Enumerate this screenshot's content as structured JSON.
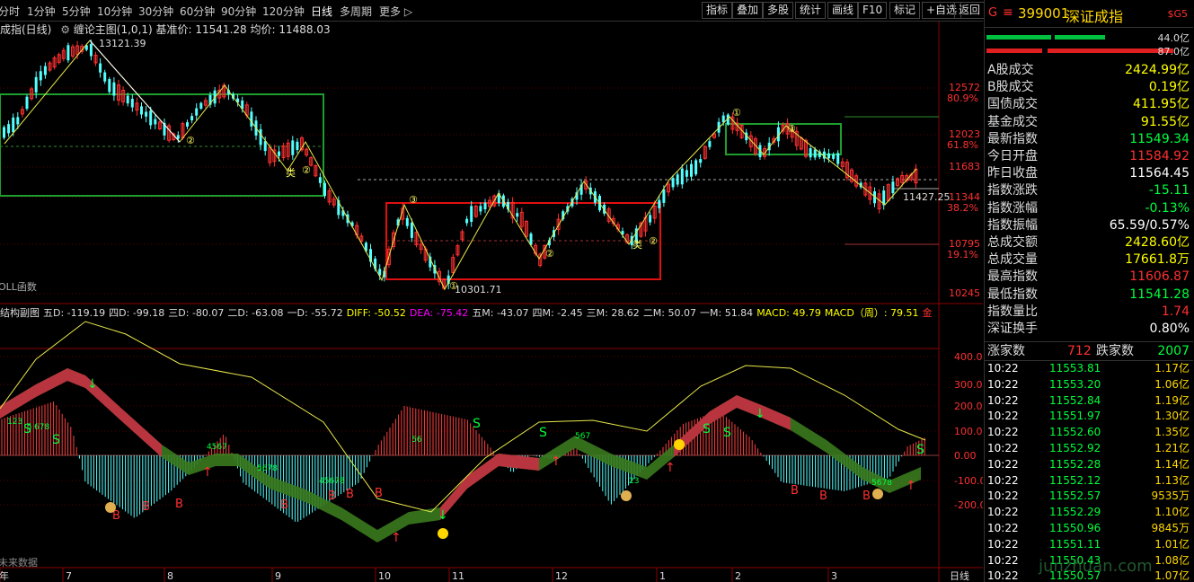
{
  "periods": [
    "分时",
    "1分钟",
    "5分钟",
    "10分钟",
    "30分钟",
    "60分钟",
    "90分钟",
    "120分钟",
    "日线",
    "多周期",
    "更多 ▷"
  ],
  "active_period": "日线",
  "toolbar": [
    "指标",
    "叠加",
    "多股",
    "统计",
    "画线",
    "F10",
    "标记",
    "+自选",
    "返回"
  ],
  "main_info": {
    "title": "成指(日线)",
    "formula": "缠论主图(1,0,1)",
    "base": "基准价: 11541.28",
    "avg": "均价: 11488.03"
  },
  "main_axis": [
    {
      "v": "12572",
      "p": "80.9%"
    },
    {
      "v": "12023",
      "p": "61.8%"
    },
    {
      "v": "11683",
      "p": ""
    },
    {
      "v": "11344",
      "p": "38.2%"
    },
    {
      "v": "10795",
      "p": "19.1%"
    },
    {
      "v": "10245",
      "p": ""
    }
  ],
  "main_labels": {
    "high": "13121.39",
    "low": "10301.71",
    "cur": "11427.25",
    "func": "OLL函数"
  },
  "sub_info": {
    "title": "结构副图",
    "items": [
      {
        "t": "五D: -119.19",
        "c": "#ddd"
      },
      {
        "t": "四D: -99.18",
        "c": "#ddd"
      },
      {
        "t": "三D: -80.07",
        "c": "#ddd"
      },
      {
        "t": "二D: -63.08",
        "c": "#ddd"
      },
      {
        "t": "一D: -55.72",
        "c": "#ddd"
      },
      {
        "t": "DIFF: -50.52",
        "c": "#ffff00"
      },
      {
        "t": "DEA: -75.42",
        "c": "#ff00ff"
      },
      {
        "t": "五M: -43.07",
        "c": "#ddd"
      },
      {
        "t": "四M: -2.45",
        "c": "#ddd"
      },
      {
        "t": "三M: 28.62",
        "c": "#ddd"
      },
      {
        "t": "二M: 50.07",
        "c": "#ddd"
      },
      {
        "t": "一M: 51.84",
        "c": "#ddd"
      },
      {
        "t": "MACD: 49.79",
        "c": "#ffff00"
      },
      {
        "t": "MACD（周）: 79.51",
        "c": "#ffff00"
      },
      {
        "t": "金",
        "c": "#ff3030"
      }
    ]
  },
  "sub_axis": [
    "400.0",
    "300.0",
    "200.0",
    "100.0",
    "0.00",
    "-100.0",
    "-200.0"
  ],
  "sub_labels": {
    "future": "未来数据"
  },
  "months": [
    "年",
    "7",
    "8",
    "9",
    "10",
    "11",
    "12",
    "1",
    "2",
    "3"
  ],
  "bottom_right": "日线",
  "right_panel": {
    "code": "399001",
    "name": "深证成指",
    "mark": "G",
    "flag": "$G5",
    "bar1": "44.0亿",
    "bar2": "87.0亿",
    "rows": [
      {
        "l": "A股成交",
        "v": "2424.99亿",
        "c": "#ffff00"
      },
      {
        "l": "B股成交",
        "v": "0.19亿",
        "c": "#ffff00"
      },
      {
        "l": "国债成交",
        "v": "411.95亿",
        "c": "#ffff00"
      },
      {
        "l": "基金成交",
        "v": "91.55亿",
        "c": "#ffff00"
      },
      {
        "l": "最新指数",
        "v": "11549.34",
        "c": "#00ff3c"
      },
      {
        "l": "今日开盘",
        "v": "11584.92",
        "c": "#ff3030"
      },
      {
        "l": "昨日收盘",
        "v": "11564.45",
        "c": "#ffffff"
      },
      {
        "l": "指数涨跌",
        "v": "-15.11",
        "c": "#00ff3c"
      },
      {
        "l": "指数涨幅",
        "v": "-0.13%",
        "c": "#00ff3c"
      },
      {
        "l": "指数振幅",
        "v": "65.59/0.57%",
        "c": "#ffffff"
      },
      {
        "l": "总成交额",
        "v": "2428.60亿",
        "c": "#ffff00"
      },
      {
        "l": "总成交量",
        "v": "17661.8万",
        "c": "#ffff00"
      },
      {
        "l": "最高指数",
        "v": "11606.87",
        "c": "#ff3030"
      },
      {
        "l": "最低指数",
        "v": "11541.28",
        "c": "#00ff3c"
      },
      {
        "l": "指数量比",
        "v": "1.74",
        "c": "#ff3030"
      },
      {
        "l": "深证换手",
        "v": "0.80%",
        "c": "#ffffff"
      }
    ],
    "updown": {
      "up_label": "涨家数",
      "up": "712",
      "down_label": "跌家数",
      "down": "2007"
    },
    "ticks": [
      {
        "t": "10:22",
        "p": "11553.81",
        "v": "1.17亿"
      },
      {
        "t": "10:22",
        "p": "11553.20",
        "v": "1.06亿"
      },
      {
        "t": "10:22",
        "p": "11552.84",
        "v": "1.19亿"
      },
      {
        "t": "10:22",
        "p": "11551.97",
        "v": "1.30亿"
      },
      {
        "t": "10:22",
        "p": "11552.60",
        "v": "1.35亿"
      },
      {
        "t": "10:22",
        "p": "11552.92",
        "v": "1.21亿"
      },
      {
        "t": "10:22",
        "p": "11552.28",
        "v": "1.14亿"
      },
      {
        "t": "10:22",
        "p": "11552.12",
        "v": "1.13亿"
      },
      {
        "t": "10:22",
        "p": "11552.57",
        "v": "9535万"
      },
      {
        "t": "10:22",
        "p": "11552.29",
        "v": "1.10亿"
      },
      {
        "t": "10:22",
        "p": "11550.96",
        "v": "9845万"
      },
      {
        "t": "10:22",
        "p": "11551.11",
        "v": "1.01亿"
      },
      {
        "t": "10:22",
        "p": "11550.43",
        "v": "1.08亿"
      },
      {
        "t": "10:22",
        "p": "11550.57",
        "v": "1.07亿"
      }
    ],
    "watermark": "junzhuan.com"
  }
}
